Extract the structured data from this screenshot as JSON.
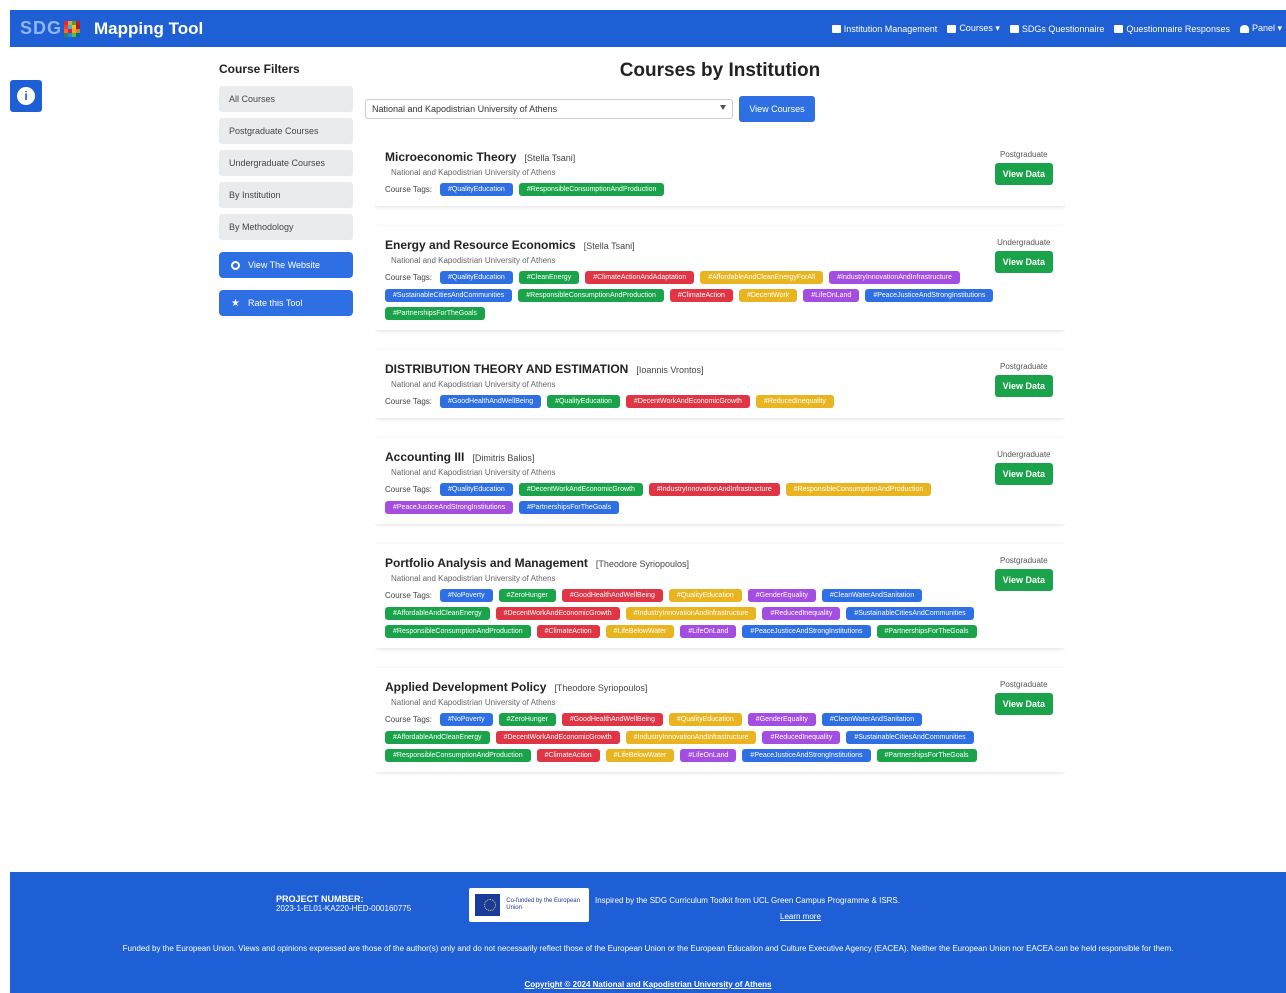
{
  "header": {
    "logo_text": "SDG",
    "brand": "Mapping Tool",
    "nav": [
      {
        "label": "Institution Management",
        "icon": "building-icon"
      },
      {
        "label": "Courses ▾",
        "icon": "book-icon"
      },
      {
        "label": "SDGs Questionnaire",
        "icon": "list-icon"
      },
      {
        "label": "Questionnaire Responses",
        "icon": "file-icon"
      },
      {
        "label": "Panel ▾",
        "icon": "user-icon"
      }
    ],
    "accent": "#1f5fd6"
  },
  "side_badge": {
    "icon": "info-icon",
    "glyph": "i"
  },
  "filters": {
    "title": "Course Filters",
    "items": [
      "All Courses",
      "Postgraduate Courses",
      "Undergraduate Courses",
      "By Institution",
      "By Methodology"
    ],
    "buttons": [
      {
        "label": "View The Website",
        "icon": "ring-icon"
      },
      {
        "label": "Rate this Tool",
        "icon": "star-icon"
      }
    ]
  },
  "main": {
    "title": "Courses by Institution",
    "select_value": "National and Kapodistrian University of Athens",
    "view_button": "View Courses"
  },
  "courses": [
    {
      "title": "Microeconomic Theory",
      "instructor": "[Stella Tsani]",
      "university": "National and Kapodistrian University of Athens",
      "level": "Postgraduate",
      "tags_label": "Course Tags:",
      "tags": [
        {
          "text": "#QualityEducation",
          "color": "blue"
        },
        {
          "text": "#ResponsibleConsumptionAndProduction",
          "color": "green"
        }
      ]
    },
    {
      "title": "Energy and Resource Economics",
      "instructor": "[Stella Tsani]",
      "university": "National and Kapodistrian University of Athens",
      "level": "Undergraduate",
      "tags_label": "Course Tags:",
      "tags": [
        {
          "text": "#QualityEducation",
          "color": "blue"
        },
        {
          "text": "#CleanEnergy",
          "color": "green"
        },
        {
          "text": "#ClimateActionAndAdaptation",
          "color": "red"
        },
        {
          "text": "#AffordableAndCleanEnergyForAll",
          "color": "yellow"
        },
        {
          "text": "#IndustryInnovationAndInfrastructure",
          "color": "purple"
        },
        {
          "text": "#SustainableCitiesAndCommunities",
          "color": "blue"
        },
        {
          "text": "#ResponsibleConsumptionAndProduction",
          "color": "green"
        },
        {
          "text": "#ClimateAction",
          "color": "red"
        },
        {
          "text": "#DecentWork",
          "color": "yellow"
        },
        {
          "text": "#LifeOnLand",
          "color": "purple"
        },
        {
          "text": "#PeaceJusticeAndStrongInstitutions",
          "color": "blue"
        },
        {
          "text": "#PartnershipsForTheGoals",
          "color": "green"
        }
      ]
    },
    {
      "title": "DISTRIBUTION THEORY AND ESTIMATION",
      "instructor": "[Ioannis Vrontos]",
      "university": "National and Kapodistrian University of Athens",
      "level": "Postgraduate",
      "tags_label": "Course Tags:",
      "tags": [
        {
          "text": "#GoodHealthAndWellBeing",
          "color": "blue"
        },
        {
          "text": "#QualityEducation",
          "color": "green"
        },
        {
          "text": "#DecentWorkAndEconomicGrowth",
          "color": "red"
        },
        {
          "text": "#ReducedInequality",
          "color": "yellow"
        }
      ]
    },
    {
      "title": "Accounting III",
      "instructor": "[Dimitris Balios]",
      "university": "National and Kapodistrian University of Athens",
      "level": "Undergraduate",
      "tags_label": "Course Tags:",
      "tags": [
        {
          "text": "#QualityEducation",
          "color": "blue"
        },
        {
          "text": "#DecentWorkAndEconomicGrowth",
          "color": "green"
        },
        {
          "text": "#IndustryInnovationAndInfrastructure",
          "color": "red"
        },
        {
          "text": "#ResponsibleConsumptionAndProduction",
          "color": "yellow"
        },
        {
          "text": "#PeaceJusticeAndStrongInstitutions",
          "color": "purple"
        },
        {
          "text": "#PartnershipsForTheGoals",
          "color": "blue"
        }
      ]
    },
    {
      "title": "Portfolio Analysis and Management",
      "instructor": "[Theodore Syriopoulos]",
      "university": "National and Kapodistrian University of Athens",
      "level": "Postgraduate",
      "tags_label": "Course Tags:",
      "tags": [
        {
          "text": "#NoPoverty",
          "color": "blue"
        },
        {
          "text": "#ZeroHunger",
          "color": "green"
        },
        {
          "text": "#GoodHealthAndWellBeing",
          "color": "red"
        },
        {
          "text": "#QualityEducation",
          "color": "yellow"
        },
        {
          "text": "#GenderEquality",
          "color": "purple"
        },
        {
          "text": "#CleanWaterAndSanitation",
          "color": "blue"
        },
        {
          "text": "#AffordableAndCleanEnergy",
          "color": "green"
        },
        {
          "text": "#DecentWorkAndEconomicGrowth",
          "color": "red"
        },
        {
          "text": "#IndustryInnovationAndInfrastructure",
          "color": "yellow"
        },
        {
          "text": "#ReducedInequality",
          "color": "purple"
        },
        {
          "text": "#SustainableCitiesAndCommunities",
          "color": "blue"
        },
        {
          "text": "#ResponsibleConsumptionAndProduction",
          "color": "green"
        },
        {
          "text": "#ClimateAction",
          "color": "red"
        },
        {
          "text": "#LifeBelowWater",
          "color": "yellow"
        },
        {
          "text": "#LifeOnLand",
          "color": "purple"
        },
        {
          "text": "#PeaceJusticeAndStrongInstitutions",
          "color": "blue"
        },
        {
          "text": "#PartnershipsForTheGoals",
          "color": "green"
        }
      ]
    },
    {
      "title": "Applied Development Policy",
      "instructor": "[Theodore Syriopoulos]",
      "university": "National and Kapodistrian University of Athens",
      "level": "Postgraduate",
      "tags_label": "Course Tags:",
      "tags": [
        {
          "text": "#NoPoverty",
          "color": "blue"
        },
        {
          "text": "#ZeroHunger",
          "color": "green"
        },
        {
          "text": "#GoodHealthAndWellBeing",
          "color": "red"
        },
        {
          "text": "#QualityEducation",
          "color": "yellow"
        },
        {
          "text": "#GenderEquality",
          "color": "purple"
        },
        {
          "text": "#CleanWaterAndSanitation",
          "color": "blue"
        },
        {
          "text": "#AffordableAndCleanEnergy",
          "color": "green"
        },
        {
          "text": "#DecentWorkAndEconomicGrowth",
          "color": "red"
        },
        {
          "text": "#IndustryInnovationAndInfrastructure",
          "color": "yellow"
        },
        {
          "text": "#ReducedInequality",
          "color": "purple"
        },
        {
          "text": "#SustainableCitiesAndCommunities",
          "color": "blue"
        },
        {
          "text": "#ResponsibleConsumptionAndProduction",
          "color": "green"
        },
        {
          "text": "#ClimateAction",
          "color": "red"
        },
        {
          "text": "#LifeBelowWater",
          "color": "yellow"
        },
        {
          "text": "#LifeOnLand",
          "color": "purple"
        },
        {
          "text": "#PeaceJusticeAndStrongInstitutions",
          "color": "blue"
        },
        {
          "text": "#PartnershipsForTheGoals",
          "color": "green"
        }
      ]
    }
  ],
  "view_data_label": "View Data",
  "footer": {
    "project_label": "PROJECT NUMBER:",
    "project_number": "2023-1-EL01-KA220-HED-000160775",
    "eu_logo_text": "Co-funded by the European Union",
    "inspired": "Inspired by the SDG Curriculum Toolkit from UCL Green Campus Programme & ISRS.",
    "learn_more": "Learn more",
    "disclaimer": "Funded by the European Union. Views and opinions expressed are those of the author(s) only and do not necessarily reflect those of the European Union or the European Education and Culture Executive Agency (EACEA). Neither the European Union nor EACEA can be held responsible for them.",
    "copyright": "Copyright © 2024 National and Kapodistrian University of Athens"
  }
}
